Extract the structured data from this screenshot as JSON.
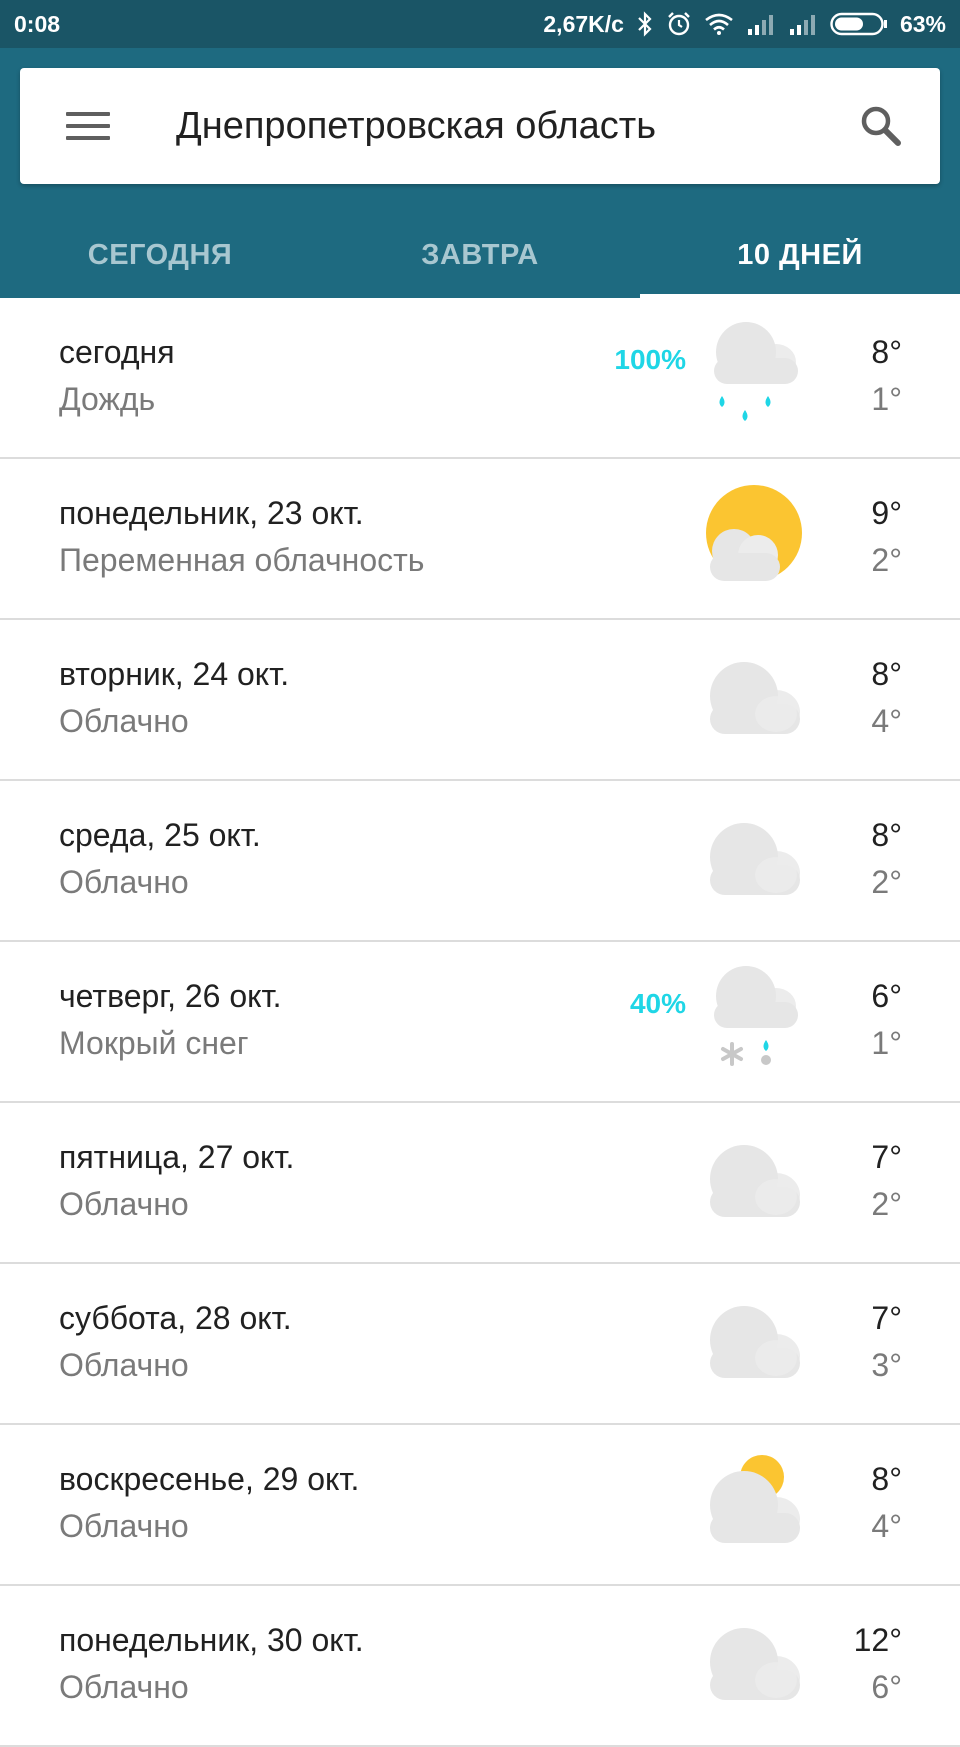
{
  "status_bar": {
    "time": "0:08",
    "net_speed": "2,67K/c",
    "battery": "63%",
    "battery_level": 0.63,
    "icons": [
      "bluetooth-icon",
      "alarm-icon",
      "wifi-icon",
      "signal-icon",
      "signal-icon",
      "battery-icon"
    ]
  },
  "search": {
    "location": "Днепропетровская область",
    "menu_icon": "hamburger-menu-icon",
    "search_icon": "search-icon"
  },
  "tabs": [
    {
      "label": "СЕГОДНЯ",
      "active": false
    },
    {
      "label": "ЗАВТРА",
      "active": false
    },
    {
      "label": "10 ДНЕЙ",
      "active": true
    }
  ],
  "colors": {
    "status_bar": "#1a5566",
    "header": "#1e6a80",
    "precip_accent": "#1fd6e6",
    "sun": "#fbc531"
  },
  "forecast": [
    {
      "day": "сегодня",
      "condition": "Дождь",
      "precip": "100%",
      "icon": "rain",
      "high": "8°",
      "low": "1°"
    },
    {
      "day": "понедельник, 23 окт.",
      "condition": "Переменная облачность",
      "precip": "",
      "icon": "partly-cloudy",
      "high": "9°",
      "low": "2°"
    },
    {
      "day": "вторник, 24 окт.",
      "condition": "Облачно",
      "precip": "",
      "icon": "cloudy",
      "high": "8°",
      "low": "4°"
    },
    {
      "day": "среда, 25 окт.",
      "condition": "Облачно",
      "precip": "",
      "icon": "cloudy",
      "high": "8°",
      "low": "2°"
    },
    {
      "day": "четверг, 26 окт.",
      "condition": "Мокрый снег",
      "precip": "40%",
      "icon": "sleet",
      "high": "6°",
      "low": "1°"
    },
    {
      "day": "пятница, 27 окт.",
      "condition": "Облачно",
      "precip": "",
      "icon": "cloudy",
      "high": "7°",
      "low": "2°"
    },
    {
      "day": "суббота, 28 окт.",
      "condition": "Облачно",
      "precip": "",
      "icon": "cloudy",
      "high": "7°",
      "low": "3°"
    },
    {
      "day": "воскресенье, 29 окт.",
      "condition": "Облачно",
      "precip": "",
      "icon": "mostly-cloudy-sun",
      "high": "8°",
      "low": "4°"
    },
    {
      "day": "понедельник, 30 окт.",
      "condition": "Облачно",
      "precip": "",
      "icon": "cloudy",
      "high": "12°",
      "low": "6°"
    }
  ]
}
